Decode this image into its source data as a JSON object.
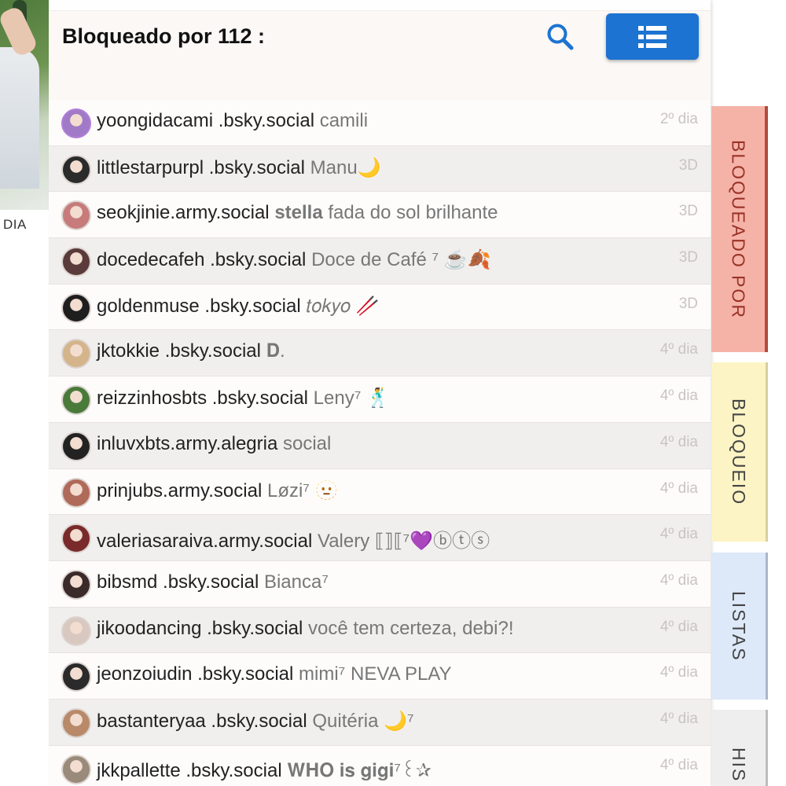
{
  "background": {
    "label": "DIA"
  },
  "header": {
    "title": "Bloqueado por 112 :"
  },
  "rows": [
    {
      "handle": "yoongidacami .bsky.social",
      "display": "camili",
      "age": "2º dia",
      "color": "#a07ac7",
      "ring": true
    },
    {
      "handle": "littlestarpurpl .bsky.social",
      "display": "Manu🌙",
      "age": "3D",
      "color": "#2b2b2b"
    },
    {
      "handle": "seokjinie.army.social",
      "display_bold": "stella",
      "display": "fada do sol brilhante",
      "age": "3D",
      "color": "#c77b7b"
    },
    {
      "handle": "docedecafeh .bsky.social",
      "display": "Doce de Café ⁷ ☕🍂",
      "age": "3D",
      "color": "#5a3a3a"
    },
    {
      "handle": "goldenmuse .bsky.social",
      "display": "𝑡𝑜𝑘𝑦𝑜 🥢",
      "age": "3D",
      "color": "#1e1e1e"
    },
    {
      "handle": "jktokkie .bsky.social",
      "display": "𝐃.",
      "age": "4º dia",
      "color": "#d4b48a"
    },
    {
      "handle": "reizzinhosbts .bsky.social",
      "display": "Leny⁷ 🕺",
      "age": "4º dia",
      "color": "#4a7a3a"
    },
    {
      "handle": "inluvxbts.army.alegria",
      "display": "social",
      "age": "4º dia",
      "color": "#222222"
    },
    {
      "handle": "prinjubs.army.social",
      "display": "Løzi⁷ 🫥",
      "age": "4º dia",
      "color": "#b06a5a"
    },
    {
      "handle": "valeriasaraiva.army.social",
      "display": "Valery ⟦⟧⟦⁷💜ⓑⓣⓢ",
      "age": "4º dia",
      "color": "#7a2a2a"
    },
    {
      "handle": "bibsmd .bsky.social",
      "display": "Bianca⁷",
      "age": "4º dia",
      "color": "#3a2a2a"
    },
    {
      "handle": "jikoodancing .bsky.social",
      "display": "você tem certeza, debi?!",
      "age": "4º dia",
      "color": "#d8c8c0"
    },
    {
      "handle": "jeonzoiudin .bsky.social",
      "display": "mimi⁷ NEVA PLAY",
      "age": "4º dia",
      "color": "#2a2a2a"
    },
    {
      "handle": "bastanteryaa .bsky.social",
      "display": "Quitéria 🌙⁷",
      "age": "4º dia",
      "color": "#b88a6a"
    },
    {
      "handle": "jkkpallette .bsky.social",
      "display": "𝐖𝐇𝐎 𝐢𝐬 𝐠𝐢𝐠𝐢⁷꒰✰",
      "age": "4º dia",
      "color": "#9a8a7a"
    }
  ],
  "tabs": {
    "blocked_by": "BLOQUEADO POR",
    "blocking": "BLOQUEIO",
    "lists": "LISTAS",
    "history": "HIS"
  },
  "icons": {
    "search": "search-icon",
    "list": "list-view-icon"
  },
  "colors": {
    "accent": "#1c73d1",
    "tab_blocked_by": "#f5b3a8",
    "tab_blocking": "#fcf4c4",
    "tab_lists": "#dde8f8",
    "tab_history": "#eeeeee"
  }
}
